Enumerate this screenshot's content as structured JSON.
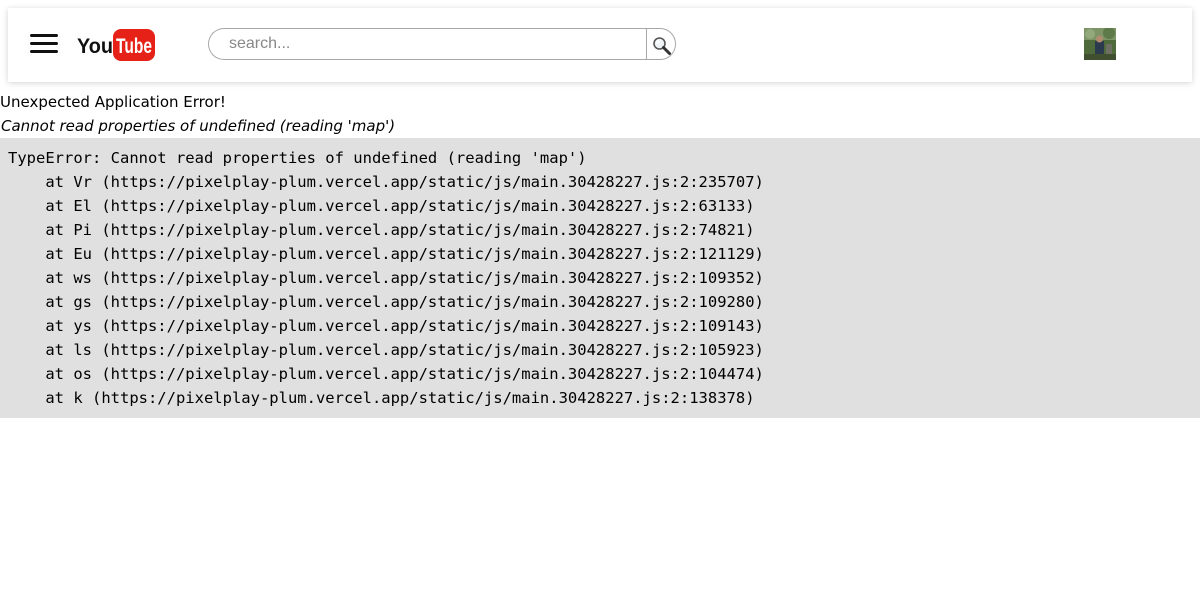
{
  "header": {
    "logo_text": "YouTube",
    "search": {
      "placeholder": "search...",
      "value": ""
    }
  },
  "error": {
    "title": "Unexpected Application Error!",
    "message": "Cannot read properties of undefined (reading 'map')",
    "stack": [
      "TypeError: Cannot read properties of undefined (reading 'map')",
      "    at Vr (https://pixelplay-plum.vercel.app/static/js/main.30428227.js:2:235707)",
      "    at El (https://pixelplay-plum.vercel.app/static/js/main.30428227.js:2:63133)",
      "    at Pi (https://pixelplay-plum.vercel.app/static/js/main.30428227.js:2:74821)",
      "    at Eu (https://pixelplay-plum.vercel.app/static/js/main.30428227.js:2:121129)",
      "    at ws (https://pixelplay-plum.vercel.app/static/js/main.30428227.js:2:109352)",
      "    at gs (https://pixelplay-plum.vercel.app/static/js/main.30428227.js:2:109280)",
      "    at ys (https://pixelplay-plum.vercel.app/static/js/main.30428227.js:2:109143)",
      "    at ls (https://pixelplay-plum.vercel.app/static/js/main.30428227.js:2:105923)",
      "    at os (https://pixelplay-plum.vercel.app/static/js/main.30428227.js:2:104474)",
      "    at k (https://pixelplay-plum.vercel.app/static/js/main.30428227.js:2:138378)"
    ]
  },
  "icons": {
    "menu": "hamburger-menu-icon",
    "search": "magnifier-icon",
    "avatar": "user-avatar"
  },
  "colors": {
    "brand_red": "#e62117",
    "stack_background": "#e0e0e0"
  }
}
